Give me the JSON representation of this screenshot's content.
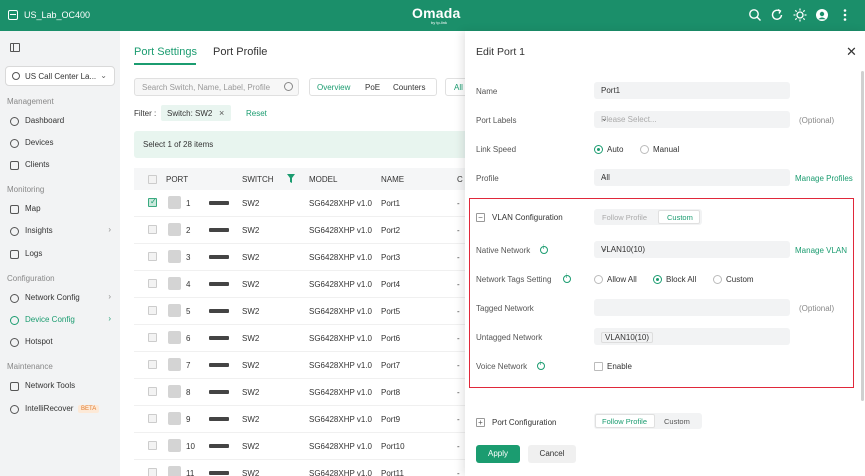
{
  "topbar": {
    "site_name": "US_Lab_OC400",
    "brand": "Omada",
    "brand_sub": "by tp-link"
  },
  "sidebar": {
    "site_select": "US Call Center La...",
    "sections": {
      "management": "Management",
      "monitoring": "Monitoring",
      "configuration": "Configuration",
      "maintenance": "Maintenance"
    },
    "items": {
      "dashboard": "Dashboard",
      "devices": "Devices",
      "clients": "Clients",
      "map": "Map",
      "insights": "Insights",
      "logs": "Logs",
      "network_config": "Network Config",
      "device_config": "Device Config",
      "hotspot": "Hotspot",
      "network_tools": "Network Tools",
      "intellirecover": "IntelliRecover",
      "beta": "BETA"
    }
  },
  "main": {
    "tabs": [
      "Port Settings",
      "Port Profile"
    ],
    "search_placeholder": "Search Switch, Name, Label, Profile",
    "view_tabs": [
      "Overview",
      "PoE",
      "Counters"
    ],
    "all_label": "All",
    "filter_label": "Filter :",
    "filter_chip": "Switch: SW2",
    "reset": "Reset",
    "selection": "Select 1 of 28 items",
    "columns": [
      "PORT",
      "SWITCH",
      "MODEL",
      "NAME",
      "C"
    ],
    "rows": [
      {
        "port": "1",
        "switch": "SW2",
        "model": "SG6428XHP v1.0",
        "name": "Port1",
        "c": "-",
        "checked": true
      },
      {
        "port": "2",
        "switch": "SW2",
        "model": "SG6428XHP v1.0",
        "name": "Port2",
        "c": "-",
        "checked": false
      },
      {
        "port": "3",
        "switch": "SW2",
        "model": "SG6428XHP v1.0",
        "name": "Port3",
        "c": "-",
        "checked": false
      },
      {
        "port": "4",
        "switch": "SW2",
        "model": "SG6428XHP v1.0",
        "name": "Port4",
        "c": "-",
        "checked": false
      },
      {
        "port": "5",
        "switch": "SW2",
        "model": "SG6428XHP v1.0",
        "name": "Port5",
        "c": "-",
        "checked": false
      },
      {
        "port": "6",
        "switch": "SW2",
        "model": "SG6428XHP v1.0",
        "name": "Port6",
        "c": "-",
        "checked": false
      },
      {
        "port": "7",
        "switch": "SW2",
        "model": "SG6428XHP v1.0",
        "name": "Port7",
        "c": "-",
        "checked": false
      },
      {
        "port": "8",
        "switch": "SW2",
        "model": "SG6428XHP v1.0",
        "name": "Port8",
        "c": "-",
        "checked": false
      },
      {
        "port": "9",
        "switch": "SW2",
        "model": "SG6428XHP v1.0",
        "name": "Port9",
        "c": "-",
        "checked": false
      },
      {
        "port": "10",
        "switch": "SW2",
        "model": "SG6428XHP v1.0",
        "name": "Port10",
        "c": "-",
        "checked": false
      },
      {
        "port": "11",
        "switch": "SW2",
        "model": "SG6428XHP v1.0",
        "name": "Port11",
        "c": "-",
        "checked": false
      }
    ]
  },
  "drawer": {
    "title": "Edit Port 1",
    "name_label": "Name",
    "name_value": "Port1",
    "port_labels_label": "Port Labels",
    "port_labels_placeholder": "Please Select...",
    "optional": "(Optional)",
    "link_speed_label": "Link Speed",
    "auto": "Auto",
    "manual": "Manual",
    "profile_label": "Profile",
    "profile_value": "All",
    "manage_profiles": "Manage Profiles",
    "vlan_section": "VLAN Configuration",
    "follow_profile": "Follow Profile",
    "custom": "Custom",
    "native_network_label": "Native Network",
    "native_network_value": "VLAN10(10)",
    "manage_vlan": "Manage VLAN",
    "tags_label": "Network Tags Setting",
    "allow_all": "Allow All",
    "block_all": "Block All",
    "custom_tag": "Custom",
    "tagged_label": "Tagged Network",
    "tagged_optional": "(Optional)",
    "untagged_label": "Untagged Network",
    "untagged_value": "VLAN10(10)",
    "voice_label": "Voice Network",
    "enable": "Enable",
    "port_config_section": "Port Configuration",
    "apply": "Apply",
    "cancel": "Cancel"
  },
  "colors": {
    "brand": "#1b8f6a",
    "accent": "#1b9c70",
    "highlight_box": "#e0283a"
  }
}
